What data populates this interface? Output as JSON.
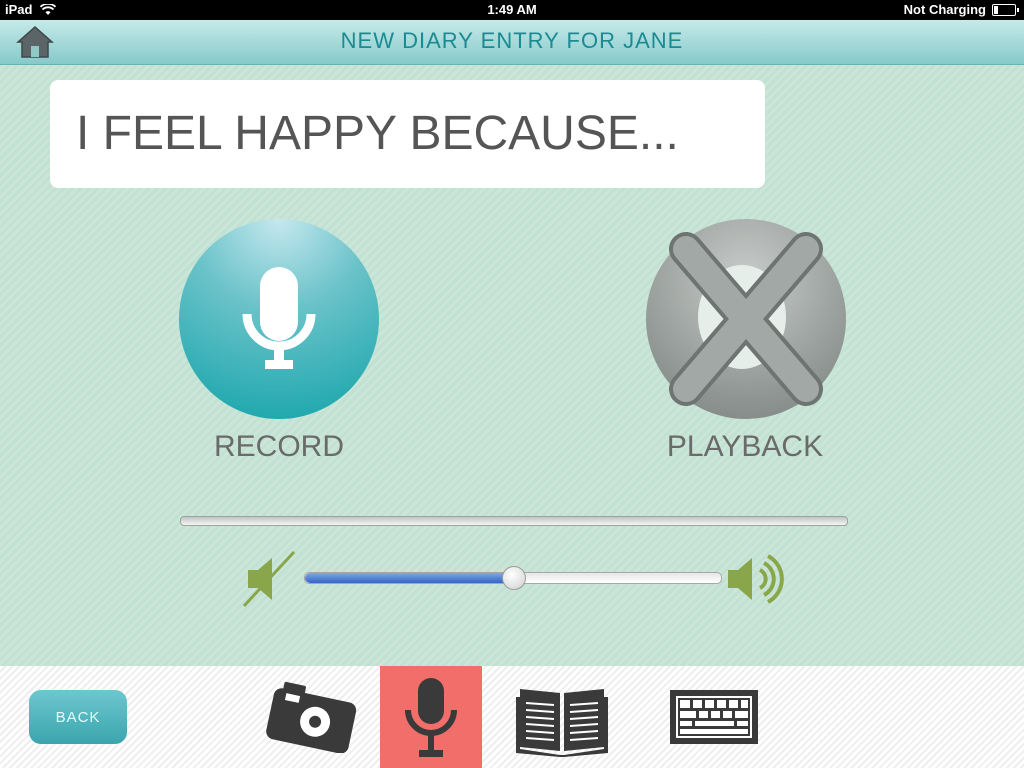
{
  "status": {
    "device": "iPad",
    "time": "1:49 AM",
    "battery": "Not Charging"
  },
  "header": {
    "title": "NEW DIARY ENTRY FOR JANE"
  },
  "prompt": {
    "text": "I FEEL HAPPY BECAUSE..."
  },
  "controls": {
    "record_label": "RECORD",
    "playback_label": "PLAYBACK"
  },
  "volume": {
    "level": 0.5
  },
  "toolbar": {
    "back_label": "BACK",
    "active_tool": "microphone"
  },
  "colors": {
    "accent": "#11a3a9",
    "active_tool_bg": "#f26e6a",
    "speaker": "#8aa64a"
  }
}
